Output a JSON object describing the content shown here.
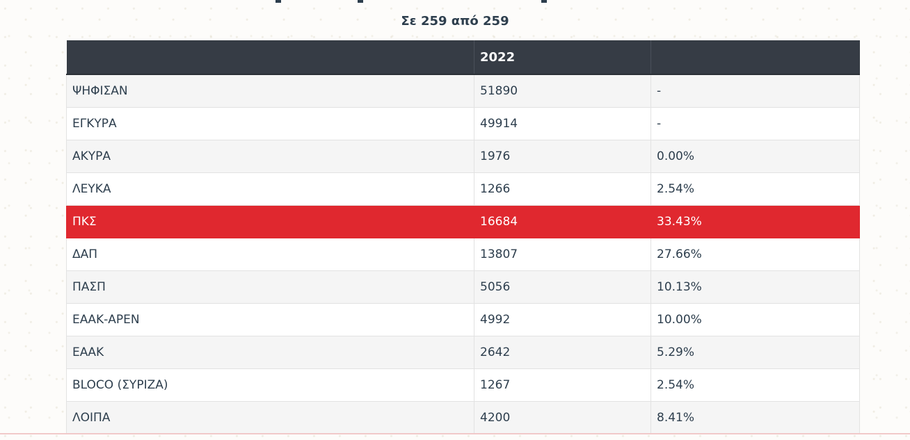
{
  "subtitle": "Σε 259 από 259",
  "table": {
    "headers": [
      "",
      "2022",
      ""
    ],
    "rows": [
      {
        "label": "ΨΗΦΙΣΑΝ",
        "votes": "51890",
        "percent": "-",
        "highlight": false
      },
      {
        "label": "ΕΓΚΥΡΑ",
        "votes": "49914",
        "percent": "-",
        "highlight": false
      },
      {
        "label": "ΑΚΥΡΑ",
        "votes": "1976",
        "percent": "0.00%",
        "highlight": false
      },
      {
        "label": "ΛΕΥΚΑ",
        "votes": "1266",
        "percent": "2.54%",
        "highlight": false
      },
      {
        "label": "ΠΚΣ",
        "votes": "16684",
        "percent": "33.43%",
        "highlight": true
      },
      {
        "label": "ΔΑΠ",
        "votes": "13807",
        "percent": "27.66%",
        "highlight": false
      },
      {
        "label": "ΠΑΣΠ",
        "votes": "5056",
        "percent": "10.13%",
        "highlight": false
      },
      {
        "label": "ΕΑΑΚ-ΑΡΕΝ",
        "votes": "4992",
        "percent": "10.00%",
        "highlight": false
      },
      {
        "label": "ΕΑΑΚ",
        "votes": "2642",
        "percent": "5.29%",
        "highlight": false
      },
      {
        "label": "BLOCO (ΣΥΡΙΖΑ)",
        "votes": "1267",
        "percent": "2.54%",
        "highlight": false
      },
      {
        "label": "ΛΟΙΠΑ",
        "votes": "4200",
        "percent": "8.41%",
        "highlight": false
      }
    ]
  },
  "colors": {
    "header_bg": "#363c45",
    "highlight": "#e0282f",
    "text": "#2d3e4d"
  }
}
